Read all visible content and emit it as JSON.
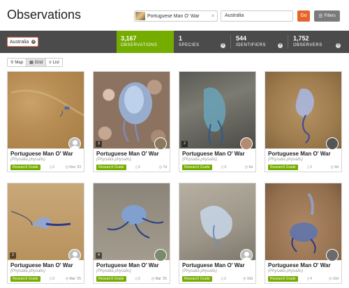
{
  "header": {
    "title": "Observations",
    "taxon_search": "Portuguese Man O' War",
    "place_search": "Australia",
    "go_label": "Go",
    "filters_label": "Filters"
  },
  "stats": {
    "place_chip": "Australia",
    "observations": {
      "count": "3,167",
      "label": "OBSERVATIONS"
    },
    "species": {
      "count": "1",
      "label": "SPECIES"
    },
    "identifiers": {
      "count": "544",
      "label": "IDENTIFIERS"
    },
    "observers": {
      "count": "1,752",
      "label": "OBSERVERS"
    }
  },
  "views": {
    "map": "Map",
    "grid": "Grid",
    "list": "List",
    "active": "Grid"
  },
  "cards": [
    {
      "title": "Portuguese Man O' War",
      "sci": "(Physalia physalis)",
      "grade": "Research Grade",
      "ids": "2",
      "date": "Nov '23",
      "photos": "",
      "avatar": "default"
    },
    {
      "title": "Portuguese Man O' War",
      "sci": "(Physalia physalis)",
      "grade": "Research Grade",
      "ids": "2",
      "date": "7d",
      "photos": "3",
      "avatar": "photo"
    },
    {
      "title": "Portuguese Man O' War",
      "sci": "(Physalia physalis)",
      "grade": "Research Grade",
      "ids": "3",
      "date": "6d",
      "photos": "2",
      "avatar": "photo"
    },
    {
      "title": "Portuguese Man O' War",
      "sci": "(Physalia physalis)",
      "grade": "Research Grade",
      "ids": "2",
      "date": "9d",
      "photos": "",
      "avatar": "photo"
    },
    {
      "title": "Portuguese Man O' War",
      "sci": "(Physalia physalis)",
      "grade": "Research Grade",
      "ids": "3",
      "date": "Mar '25",
      "photos": "2",
      "avatar": "default"
    },
    {
      "title": "Portuguese Man O' War",
      "sci": "(Physalia physalis)",
      "grade": "Research Grade",
      "ids": "2",
      "date": "Mar '25",
      "photos": "4",
      "avatar": "photo"
    },
    {
      "title": "Portuguese Man O' War",
      "sci": "(Physalia physalis)",
      "grade": "Research Grade",
      "ids": "2",
      "date": "10d",
      "photos": "",
      "avatar": "default"
    },
    {
      "title": "Portuguese Man O' War",
      "sci": "(Physalia physalis)",
      "grade": "Research Grade",
      "ids": "4",
      "date": "10d",
      "photos": "",
      "avatar": "photo"
    }
  ],
  "colors": {
    "accent_green": "#74ac00",
    "go_orange": "#e8632a",
    "statsbar": "#4b4b4b"
  }
}
